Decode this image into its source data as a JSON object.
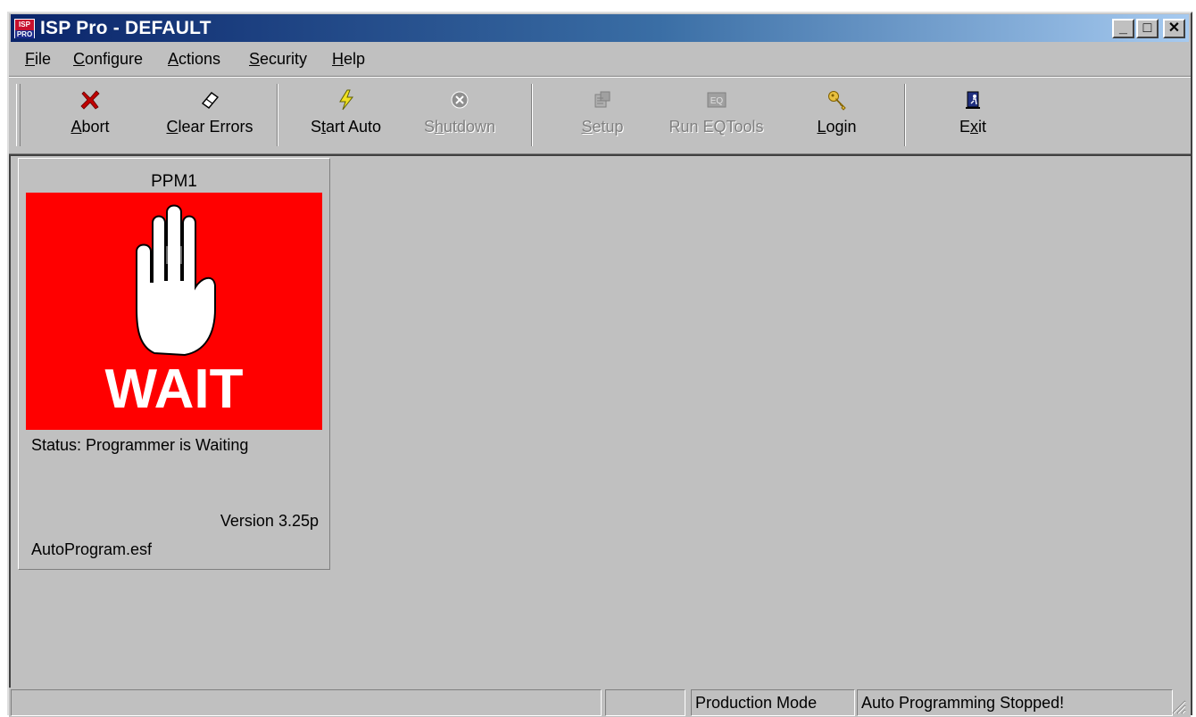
{
  "window": {
    "title": "ISP Pro - DEFAULT",
    "icon_top": "ISP",
    "icon_bottom": "PRO",
    "controls": {
      "minimize": "_",
      "maximize": "□",
      "close": "✕"
    }
  },
  "menu": [
    {
      "pre": "",
      "acc": "F",
      "post": "ile"
    },
    {
      "pre": "",
      "acc": "C",
      "post": "onfigure"
    },
    {
      "pre": "",
      "acc": "A",
      "post": "ctions"
    },
    {
      "pre": "",
      "acc": "S",
      "post": "ecurity"
    },
    {
      "pre": "",
      "acc": "H",
      "post": "elp"
    }
  ],
  "toolbar": {
    "abort": {
      "pre": "",
      "acc": "A",
      "post": "bort",
      "icon": "x-icon"
    },
    "clear_errors": {
      "pre": "",
      "acc": "C",
      "post": "lear Errors",
      "icon": "eraser-icon"
    },
    "start_auto": {
      "pre": "S",
      "acc": "t",
      "post": "art Auto",
      "icon": "lightning-icon"
    },
    "shutdown": {
      "pre": "S",
      "acc": "h",
      "post": "utdown",
      "icon": "shutdown-icon",
      "disabled": true
    },
    "setup": {
      "pre": "",
      "acc": "S",
      "post": "etup",
      "icon": "setup-icon",
      "disabled": true
    },
    "run_eqtools": {
      "pre": "Run EQTools",
      "acc": "",
      "post": "",
      "icon": "eq-icon",
      "disabled": true
    },
    "login": {
      "pre": "",
      "acc": "L",
      "post": "ogin",
      "icon": "key-icon"
    },
    "exit": {
      "pre": "E",
      "acc": "x",
      "post": "it",
      "icon": "exit-door-icon"
    }
  },
  "ppm": {
    "title": "PPM1",
    "image_text": "WAIT",
    "status": "Status: Programmer is Waiting",
    "version": "Version 3.25p",
    "file": "AutoProgram.esf",
    "colors": {
      "background": "#ff0000",
      "hand": "#ffffff"
    }
  },
  "statusbar": {
    "panel1": "",
    "panel2": "",
    "mode": "Production Mode",
    "message": "Auto Programming Stopped!"
  }
}
